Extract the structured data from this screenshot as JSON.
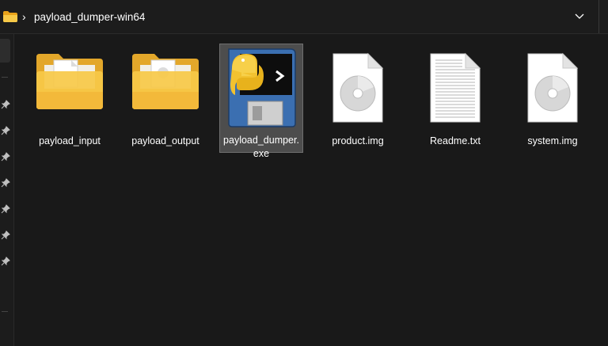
{
  "addressbar": {
    "path": "payload_dumper-win64",
    "separator": "›",
    "dropdown_icon": "chevron-down-icon"
  },
  "colors": {
    "background": "#191919",
    "folder_yellow": "#f4c542",
    "selection": "#4d4d4d"
  },
  "files": [
    {
      "name": "payload_input",
      "type": "folder",
      "icon": "folder-icon"
    },
    {
      "name": "payload_output",
      "type": "folder",
      "icon": "folder-icon"
    },
    {
      "name": "payload_dumper.exe",
      "type": "executable",
      "icon": "python-exe-icon",
      "selected": true
    },
    {
      "name": "product.img",
      "type": "disc-image",
      "icon": "disc-image-icon"
    },
    {
      "name": "Readme.txt",
      "type": "text",
      "icon": "text-file-icon"
    },
    {
      "name": "system.img",
      "type": "disc-image",
      "icon": "disc-image-icon"
    }
  ]
}
